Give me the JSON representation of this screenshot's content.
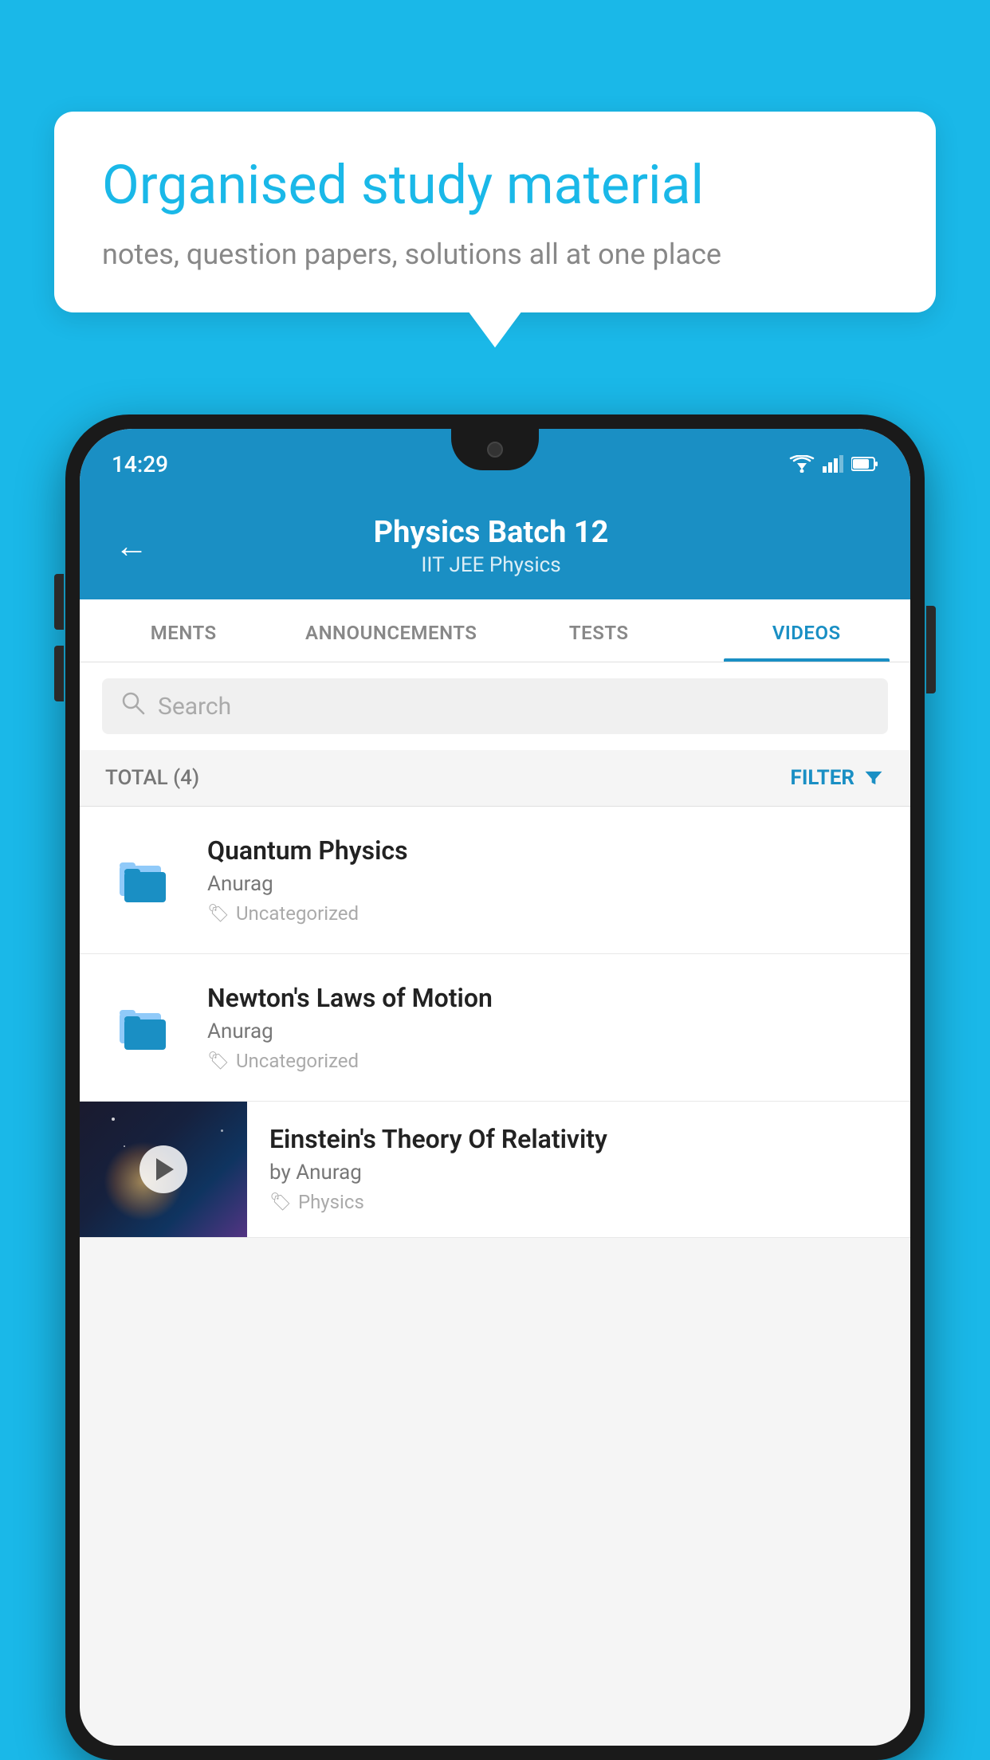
{
  "background_color": "#1ab8e8",
  "speech_bubble": {
    "title": "Organised study material",
    "subtitle": "notes, question papers, solutions all at one place"
  },
  "phone": {
    "status_bar": {
      "time": "14:29"
    },
    "header": {
      "title": "Physics Batch 12",
      "tags": "IIT JEE   Physics",
      "back_label": "←"
    },
    "tabs": [
      {
        "label": "MENTS",
        "active": false
      },
      {
        "label": "ANNOUNCEMENTS",
        "active": false
      },
      {
        "label": "TESTS",
        "active": false
      },
      {
        "label": "VIDEOS",
        "active": true
      }
    ],
    "search": {
      "placeholder": "Search"
    },
    "filter": {
      "total_label": "TOTAL (4)",
      "filter_label": "FILTER"
    },
    "videos": [
      {
        "id": 1,
        "title": "Quantum Physics",
        "author": "Anurag",
        "tag": "Uncategorized",
        "type": "folder"
      },
      {
        "id": 2,
        "title": "Newton's Laws of Motion",
        "author": "Anurag",
        "tag": "Uncategorized",
        "type": "folder"
      },
      {
        "id": 3,
        "title": "Einstein's Theory Of Relativity",
        "author": "by Anurag",
        "tag": "Physics",
        "type": "thumbnail"
      }
    ]
  }
}
